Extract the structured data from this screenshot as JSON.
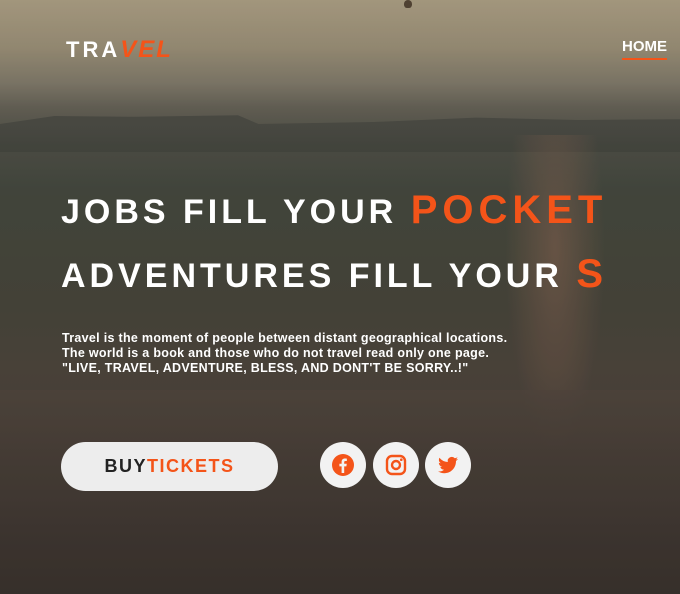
{
  "logo": {
    "part1": "TRA",
    "part2": "VEL"
  },
  "nav": {
    "home": "HOME"
  },
  "hero": {
    "line1_white": "JOBS FILL YOUR ",
    "line1_accent": "POCKET",
    "line2_white": "ADVENTURES FILL YOUR ",
    "line2_accent": "S",
    "description": [
      "Travel is the moment of people between distant geographical locations.",
      "The world is a book and those who do not travel read only one page.",
      "\"LIVE, TRAVEL, ADVENTURE, BLESS, AND DONT'T BE SORRY..!\""
    ]
  },
  "cta": {
    "buy": "BUY",
    "tickets": "TICKETS"
  },
  "social": [
    "facebook-icon",
    "instagram-icon",
    "twitter-icon"
  ],
  "colors": {
    "accent": "#f45419",
    "button_bg": "#ededed",
    "text": "#ffffff"
  }
}
